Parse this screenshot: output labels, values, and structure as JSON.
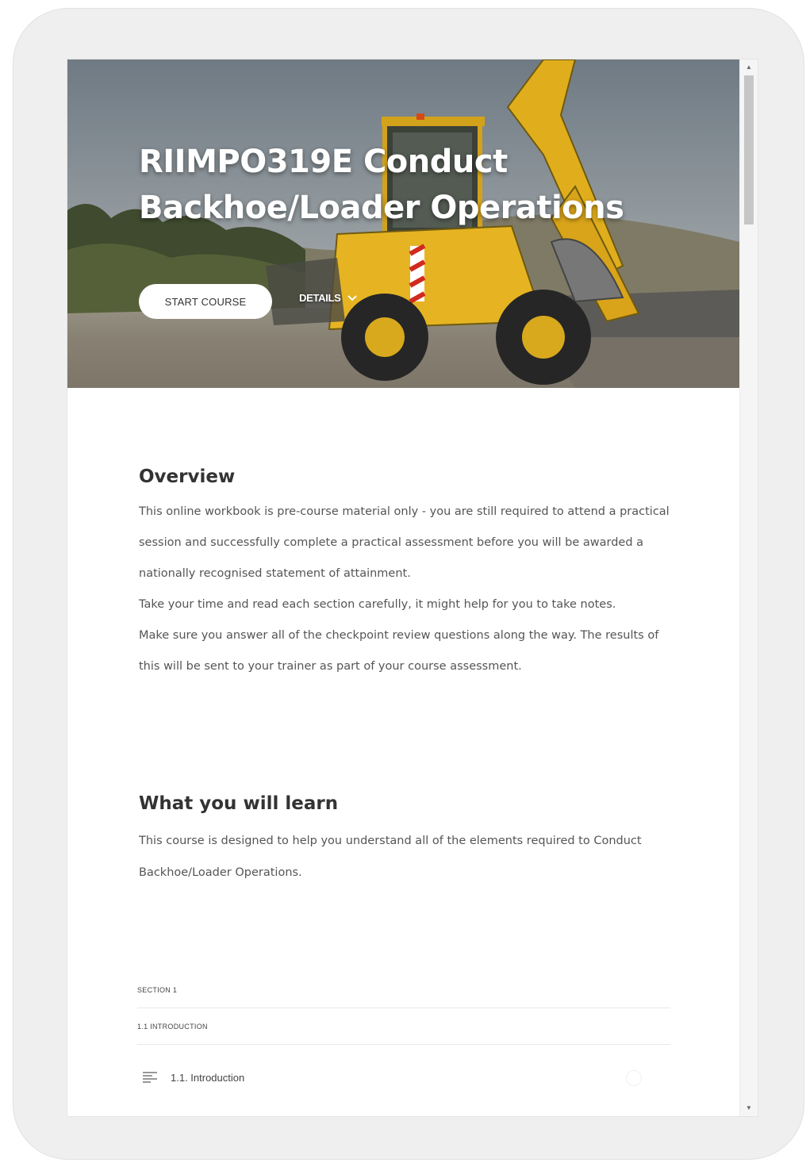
{
  "hero": {
    "title": "RIIMPO319E Conduct Backhoe/Loader Operations",
    "start_label": "START COURSE",
    "details_label": "DETAILS"
  },
  "overview": {
    "heading": "Overview",
    "paragraphs": [
      "This online workbook is pre-course material only - you are still required to attend a practical session and successfully complete a practical assessment before you will be awarded a nationally recognised statement of attainment.",
      "Take your time and read each section carefully, it might help for you to take notes.",
      "Make sure you answer all of the checkpoint review questions along the way. The results of this will be sent to your trainer as part of your course assessment."
    ]
  },
  "learn": {
    "heading": "What you will learn",
    "text": "This course is designed to help you understand all of the elements required to  Conduct Backhoe/Loader Operations."
  },
  "outline": {
    "section_label": "SECTION 1",
    "subsection_label": "1.1 INTRODUCTION",
    "lesson": {
      "label": "1.1. Introduction",
      "icon": "lesson-text-icon"
    }
  },
  "colors": {
    "machine_yellow": "#e9b921",
    "text": "#555555",
    "heading": "#333333"
  }
}
